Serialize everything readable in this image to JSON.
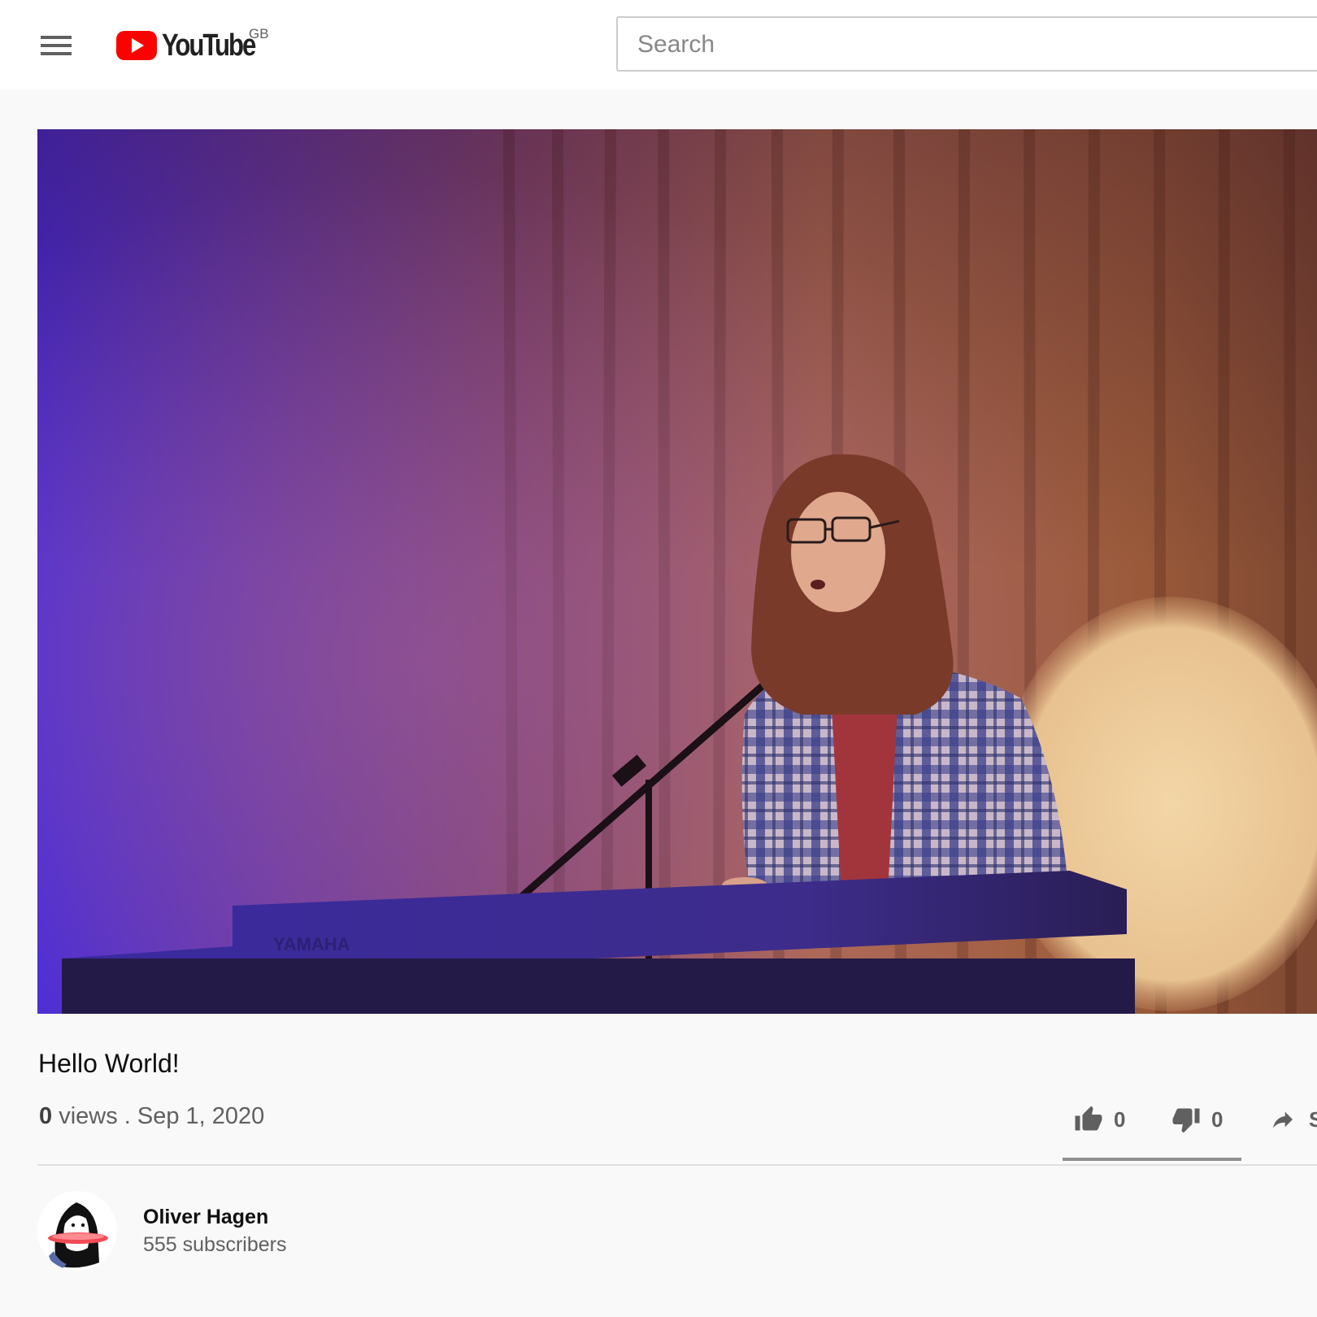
{
  "header": {
    "logo_text": "YouTube",
    "region": "GB",
    "search_placeholder": "Search",
    "brand_red": "#ff0000"
  },
  "video": {
    "title": "Hello World!",
    "views_count": "0",
    "views_label": " views . ",
    "date": "Sep 1, 2020",
    "likes": "0",
    "dislikes": "0",
    "share_label": "SHARE"
  },
  "channel": {
    "name": "Oliver Hagen",
    "subscribers": "555 subscribers"
  },
  "icons": {
    "menu": "hamburger-menu-icon",
    "like": "thumbs-up-icon",
    "dislike": "thumbs-down-icon",
    "share": "share-arrow-icon"
  }
}
